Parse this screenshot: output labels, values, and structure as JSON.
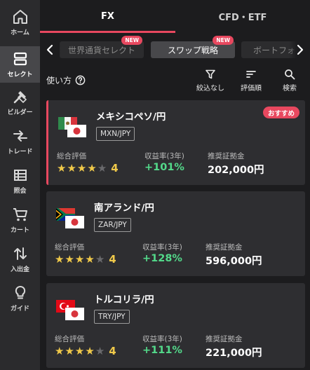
{
  "sidebar": {
    "items": [
      {
        "label": "ホーム",
        "icon": "home-icon"
      },
      {
        "label": "セレクト",
        "icon": "select-icon",
        "active": true
      },
      {
        "label": "ビルダー",
        "icon": "builder-icon"
      },
      {
        "label": "トレード",
        "icon": "trade-icon"
      },
      {
        "label": "照会",
        "icon": "inquiry-icon"
      },
      {
        "label": "カート",
        "icon": "cart-icon"
      },
      {
        "label": "入出金",
        "icon": "deposit-icon"
      },
      {
        "label": "ガイド",
        "icon": "guide-icon"
      }
    ]
  },
  "tabs": [
    {
      "label": "FX",
      "active": true
    },
    {
      "label": "CFD・ETF",
      "active": false
    }
  ],
  "chips": [
    {
      "label": "世界通貨セレクト",
      "badge": "NEW"
    },
    {
      "label": "スワップ戦略",
      "badge": "NEW",
      "active": true
    },
    {
      "label": "ボートフォ"
    }
  ],
  "toolbar": {
    "howto_label": "使い方",
    "filter_label": "絞込なし",
    "sort_label": "評価順",
    "search_label": "検索"
  },
  "labels": {
    "rating": "総合評価",
    "return": "収益率(3年)",
    "margin": "推奨証拠金"
  },
  "products": [
    {
      "name": "メキシコペソ/円",
      "code": "MXN/JPY",
      "badge": "おすすめ",
      "rating": 4,
      "rating_text": "4",
      "return": "+101%",
      "margin": "202,000円"
    },
    {
      "name": "南アランド/円",
      "code": "ZAR/JPY",
      "rating": 4,
      "rating_text": "4",
      "return": "+128%",
      "margin": "596,000円"
    },
    {
      "name": "トルコリラ/円",
      "code": "TRY/JPY",
      "rating": 4,
      "rating_text": "4",
      "return": "+111%",
      "margin": "221,000円"
    }
  ],
  "colors": {
    "accent": "#e8485f",
    "positive": "#53d98a",
    "star": "#f0c94a"
  }
}
